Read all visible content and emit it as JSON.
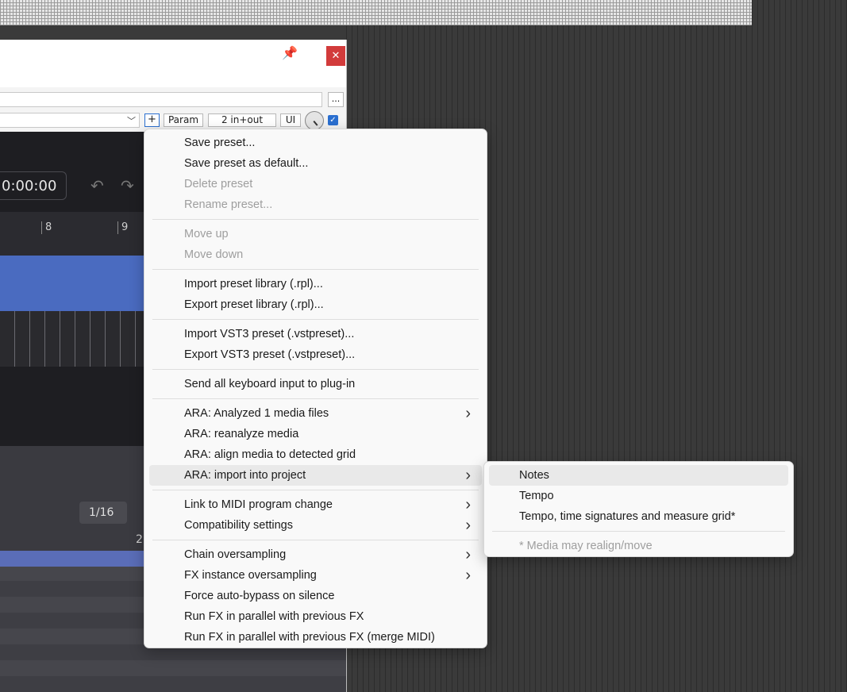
{
  "fx_window": {
    "close_label": "✕",
    "browse_label": "...",
    "add_label": "+",
    "param_label": "Param",
    "io_label": "2 in+out",
    "ui_label": "UI",
    "enable_check": "✓"
  },
  "plugin": {
    "time": "0:00:00",
    "ruler_marks": [
      "8",
      "9"
    ],
    "grid_value": "1/16",
    "ruler2_mark": "2"
  },
  "menu_main": {
    "groups": [
      [
        {
          "label": "Save preset...",
          "disabled": false
        },
        {
          "label": "Save preset as default...",
          "disabled": false
        },
        {
          "label": "Delete preset",
          "disabled": true
        },
        {
          "label": "Rename preset...",
          "disabled": true
        }
      ],
      [
        {
          "label": "Move up",
          "disabled": true
        },
        {
          "label": "Move down",
          "disabled": true
        }
      ],
      [
        {
          "label": "Import preset library (.rpl)...",
          "disabled": false
        },
        {
          "label": "Export preset library (.rpl)...",
          "disabled": false
        }
      ],
      [
        {
          "label": "Import VST3 preset (.vstpreset)...",
          "disabled": false
        },
        {
          "label": "Export VST3 preset (.vstpreset)...",
          "disabled": false
        }
      ],
      [
        {
          "label": "Send all keyboard input to plug-in",
          "disabled": false
        }
      ],
      [
        {
          "label": "ARA: Analyzed 1 media files",
          "disabled": false,
          "submenu": true
        },
        {
          "label": "ARA: reanalyze media",
          "disabled": false
        },
        {
          "label": "ARA: align media to detected grid",
          "disabled": false
        },
        {
          "label": "ARA: import into project",
          "disabled": false,
          "submenu": true,
          "highlighted": true
        }
      ],
      [
        {
          "label": "Link to MIDI program change",
          "disabled": false,
          "submenu": true
        },
        {
          "label": "Compatibility settings",
          "disabled": false,
          "submenu": true
        }
      ],
      [
        {
          "label": "Chain oversampling",
          "disabled": false,
          "submenu": true
        },
        {
          "label": "FX instance oversampling",
          "disabled": false,
          "submenu": true
        },
        {
          "label": "Force auto-bypass on silence",
          "disabled": false
        },
        {
          "label": "Run FX in parallel with previous FX",
          "disabled": false
        },
        {
          "label": "Run FX in parallel with previous FX (merge MIDI)",
          "disabled": false
        }
      ]
    ]
  },
  "menu_sub": {
    "groups": [
      [
        {
          "label": "Notes",
          "disabled": false,
          "highlighted": true
        },
        {
          "label": "Tempo",
          "disabled": false
        },
        {
          "label": "Tempo, time signatures and measure grid*",
          "disabled": false
        }
      ],
      [
        {
          "label": "* Media may realign/move",
          "disabled": true
        }
      ]
    ]
  }
}
